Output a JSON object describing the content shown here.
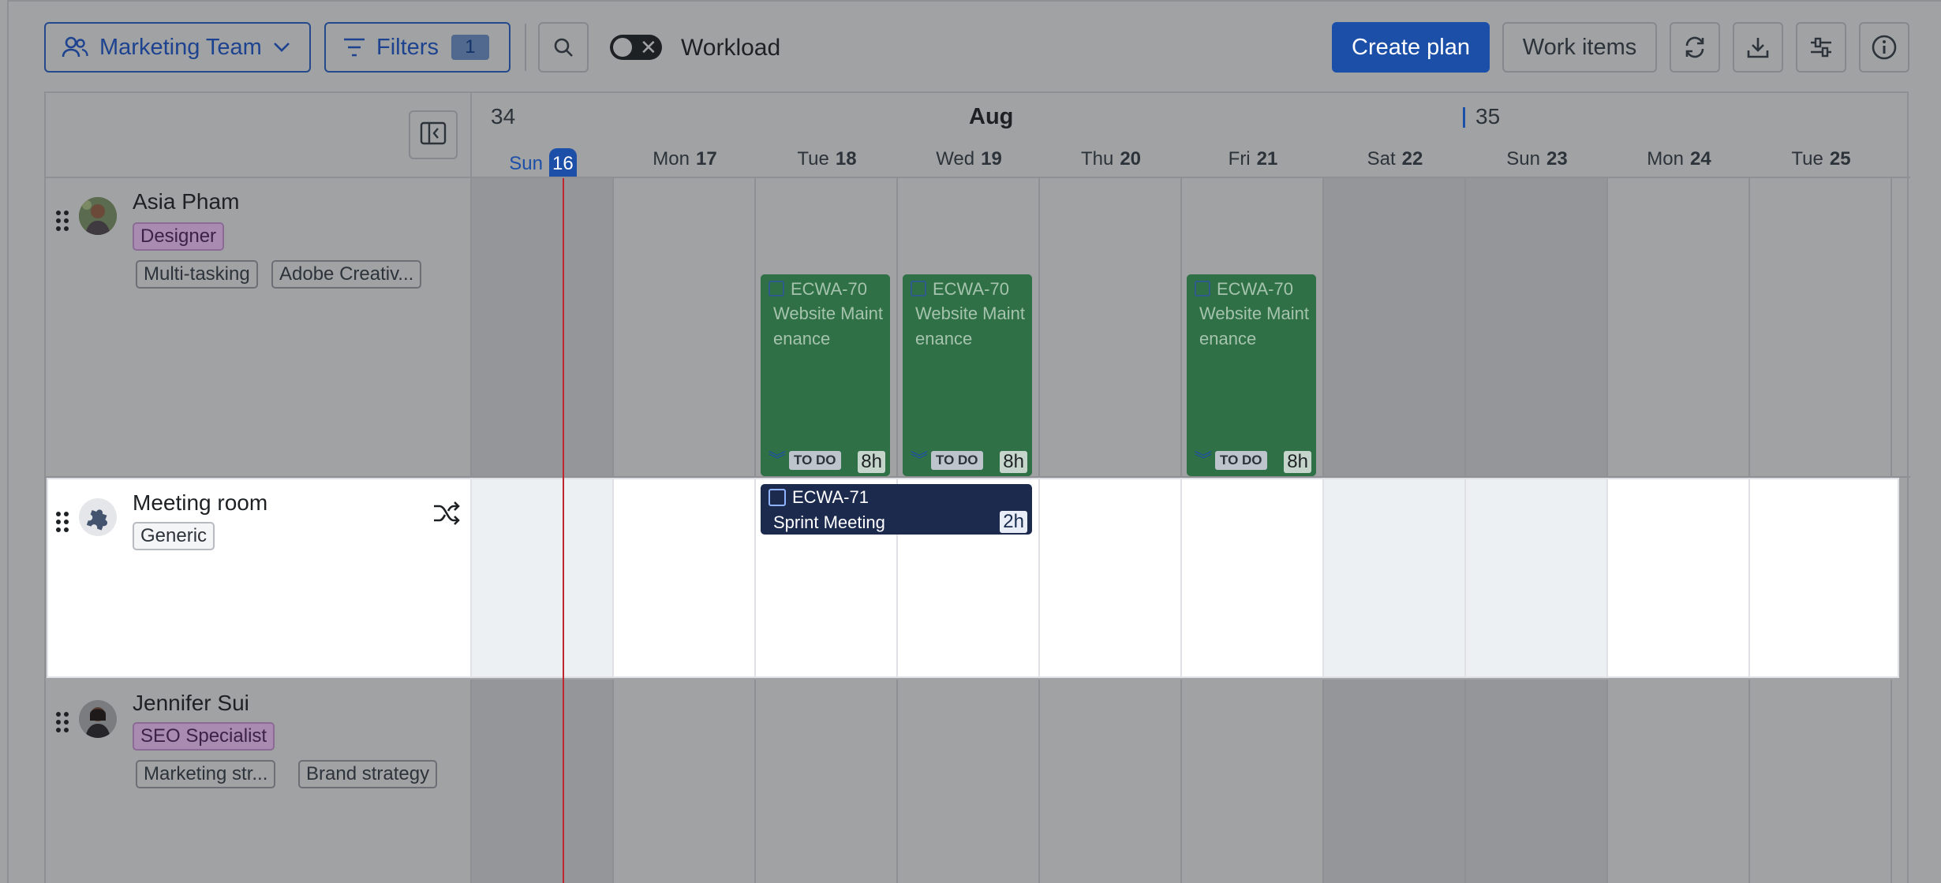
{
  "toolbar": {
    "team_label": "Marketing Team",
    "filters_label": "Filters",
    "filters_count": "1",
    "workload_label": "Workload",
    "workload_on": false,
    "create_plan_label": "Create plan",
    "work_items_label": "Work items"
  },
  "timeline": {
    "week_start": "34",
    "week_next": "35",
    "month": "Aug",
    "days": [
      {
        "name": "Sun",
        "num": "16"
      },
      {
        "name": "Mon",
        "num": "17"
      },
      {
        "name": "Tue",
        "num": "18"
      },
      {
        "name": "Wed",
        "num": "19"
      },
      {
        "name": "Thu",
        "num": "20"
      },
      {
        "name": "Fri",
        "num": "21"
      },
      {
        "name": "Sat",
        "num": "22"
      },
      {
        "name": "Sun",
        "num": "23"
      },
      {
        "name": "Mon",
        "num": "24"
      },
      {
        "name": "Tue",
        "num": "25"
      }
    ]
  },
  "rows": [
    {
      "name": "Asia Pham",
      "role": "Designer",
      "skills": [
        "Multi-tasking",
        "Adobe Creativ..."
      ],
      "cards": [
        {
          "id": "ECWA-70",
          "title": "Website Maintenance",
          "status": "TO DO",
          "hours": "8h"
        },
        {
          "id": "ECWA-70",
          "title": "Website Maintenance",
          "status": "TO DO",
          "hours": "8h"
        },
        {
          "id": "ECWA-70",
          "title": "Website Maintenance",
          "status": "TO DO",
          "hours": "8h"
        }
      ]
    },
    {
      "name": "Meeting room",
      "role": "Generic",
      "skills": [],
      "cards": [
        {
          "id": "ECWA-71",
          "title": "Sprint Meeting",
          "hours": "2h"
        }
      ]
    },
    {
      "name": "Jennifer Sui",
      "role": "SEO Specialist",
      "skills": [
        "Marketing str...",
        "Brand strategy"
      ],
      "cards": []
    }
  ],
  "colors": {
    "primary": "#1c4fa8",
    "task_green": "#2f7046",
    "task_dark": "#1c2a4e",
    "today_line": "#c0262d",
    "overlay": "#a1a2a3"
  }
}
